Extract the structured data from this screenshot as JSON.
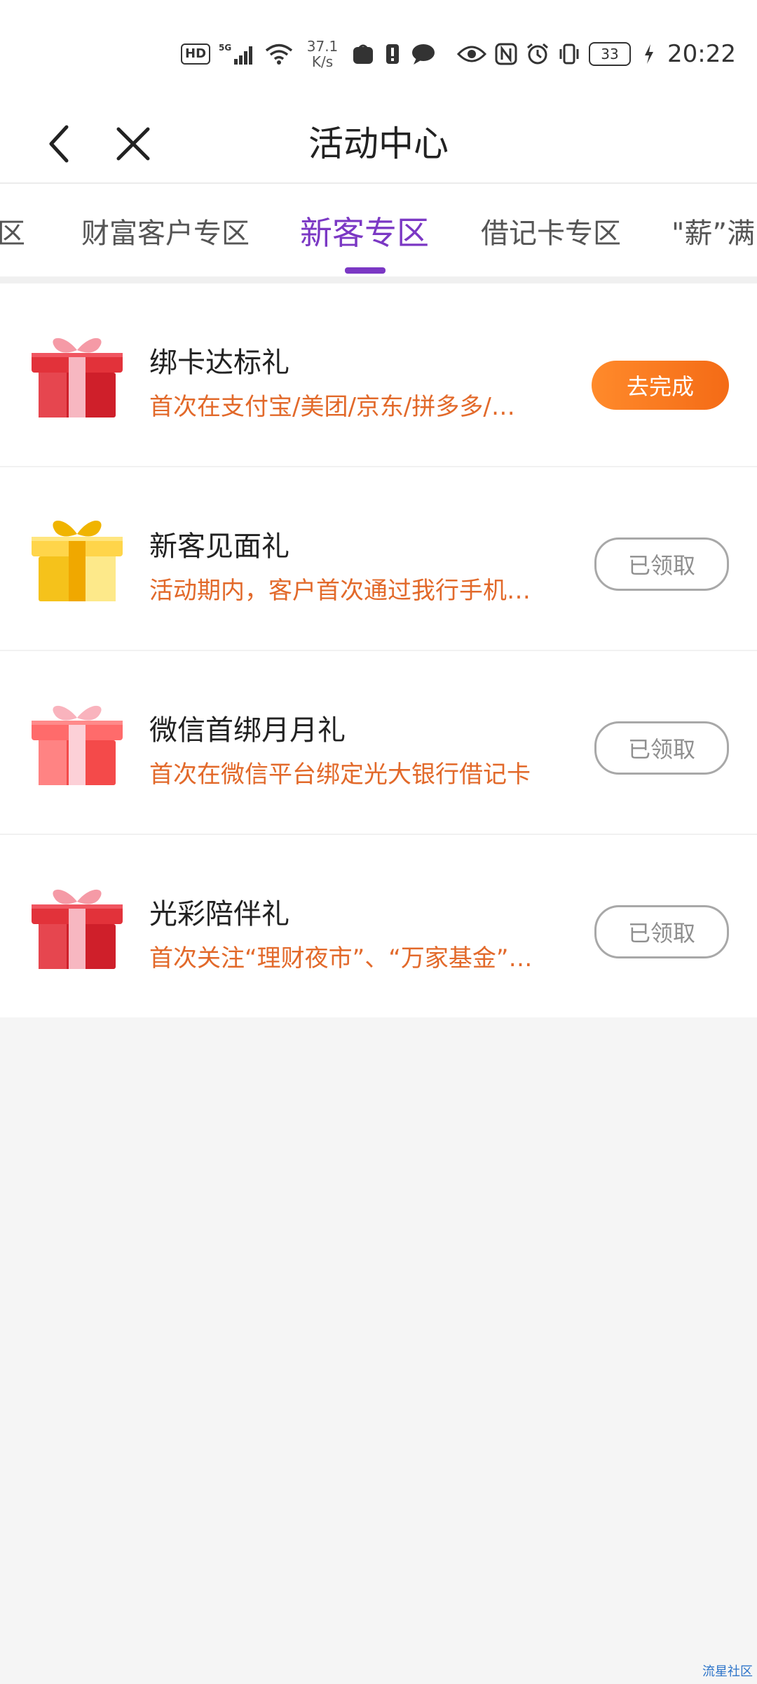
{
  "status_bar": {
    "hd": "HD",
    "network": "5G",
    "speed_value": "37.1",
    "speed_unit": "K/s",
    "battery": "33",
    "time": "20:22",
    "icons": [
      "hd-icon",
      "signal-icon",
      "wifi-icon",
      "shopping-bag-icon",
      "alert-icon",
      "chat-icon",
      "eye-icon",
      "nfc-icon",
      "alarm-icon",
      "vibrate-icon",
      "battery-icon",
      "charging-icon"
    ]
  },
  "header": {
    "title": "活动中心",
    "back_icon": "chevron-left-icon",
    "close_icon": "close-icon"
  },
  "tabs": [
    {
      "label": "区",
      "active": false
    },
    {
      "label": "财富客户专区",
      "active": false
    },
    {
      "label": "新客专区",
      "active": true
    },
    {
      "label": "借记卡专区",
      "active": false
    },
    {
      "label": "\"薪”满",
      "active": false
    }
  ],
  "accent_color": "#7b38c4",
  "desc_color": "#e2692a",
  "button_color": "#f46b16",
  "items": [
    {
      "title": "绑卡达标礼",
      "desc": "首次在支付宝/美团/京东/拼多多/…",
      "button": "去完成",
      "status": "todo",
      "icon": "gift-red-icon"
    },
    {
      "title": "新客见面礼",
      "desc": "活动期内，客户首次通过我行手机…",
      "button": "已领取",
      "status": "claimed",
      "icon": "gift-yellow-icon"
    },
    {
      "title": "微信首绑月月礼",
      "desc": "首次在微信平台绑定光大银行借记卡",
      "button": "已领取",
      "status": "claimed",
      "icon": "gift-pink-icon"
    },
    {
      "title": "光彩陪伴礼",
      "desc": "首次关注“理财夜市”、“万家基金”…",
      "button": "已领取",
      "status": "claimed",
      "icon": "gift-red-icon"
    }
  ],
  "watermark": "流星社区"
}
